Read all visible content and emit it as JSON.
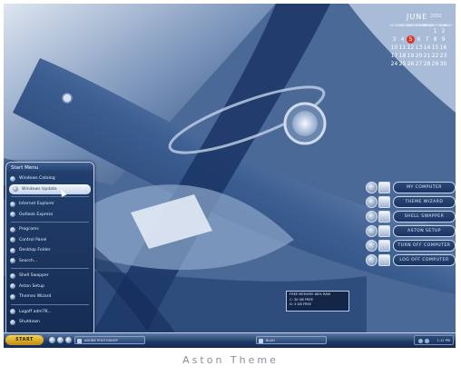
{
  "caption": "Aston Theme",
  "calendar": {
    "month": "JUNE",
    "year": "2002",
    "weekdays": [
      "MONDAY",
      "TUESDAY",
      "WEDNESDAY",
      "THURSDAY",
      "FRIDAY",
      "SATURDAY",
      "SUNDAY"
    ],
    "weeks": [
      [
        "",
        "",
        "",
        "",
        "",
        "1",
        "2"
      ],
      [
        "3",
        "4",
        "5",
        "6",
        "7",
        "8",
        "9"
      ],
      [
        "10",
        "11",
        "12",
        "13",
        "14",
        "15",
        "16"
      ],
      [
        "17",
        "18",
        "19",
        "20",
        "21",
        "22",
        "23"
      ],
      [
        "24",
        "25",
        "26",
        "27",
        "28",
        "29",
        "30"
      ]
    ],
    "today": "5"
  },
  "shortcuts": [
    {
      "label": "MY COMPUTER",
      "icon": "computer-icon"
    },
    {
      "label": "THEME WIZARD",
      "icon": "wizard-icon"
    },
    {
      "label": "SHELL SWAPPER",
      "icon": "swap-icon"
    },
    {
      "label": "ASTON SETUP",
      "icon": "aston-icon"
    },
    {
      "label": "TURN OFF COMPUTER",
      "icon": "power-icon"
    },
    {
      "label": "LOG OFF COMPUTER",
      "icon": "logoff-icon"
    }
  ],
  "memory": {
    "line1": "FREE MEMORY: 68% RAM",
    "line2": "C: 30 GB FREE",
    "line3": "D: 3 GB FREE"
  },
  "start_menu": {
    "title": "Start Menu",
    "items": [
      {
        "label": "Windows Catalog",
        "highlight": false,
        "sep_after": false
      },
      {
        "label": "Windows Update",
        "highlight": true,
        "sep_after": true
      },
      {
        "label": "Internet Explorer",
        "highlight": false,
        "sep_after": false
      },
      {
        "label": "Outlook Express",
        "highlight": false,
        "sep_after": true
      },
      {
        "label": "Programs",
        "highlight": false,
        "sep_after": false
      },
      {
        "label": "Control Panel",
        "highlight": false,
        "sep_after": false
      },
      {
        "label": "Desktop Folder",
        "highlight": false,
        "sep_after": false
      },
      {
        "label": "Search...",
        "highlight": false,
        "sep_after": true
      },
      {
        "label": "Shell Swapper",
        "highlight": false,
        "sep_after": false
      },
      {
        "label": "Aston Setup",
        "highlight": false,
        "sep_after": false
      },
      {
        "label": "Themes Wizard",
        "highlight": false,
        "sep_after": true
      },
      {
        "label": "Logoff admTK...",
        "highlight": false,
        "sep_after": false
      },
      {
        "label": "Shutdown",
        "highlight": false,
        "sep_after": false
      }
    ]
  },
  "taskbar": {
    "start_label": "START",
    "tasks": [
      "ADOBE PHOTOSHOP",
      "BLAH"
    ],
    "clock": "1:12 PM"
  },
  "colors": {
    "accent": "#1a3462",
    "start_button": "#e0b42c",
    "today_marker": "#d9362b"
  }
}
